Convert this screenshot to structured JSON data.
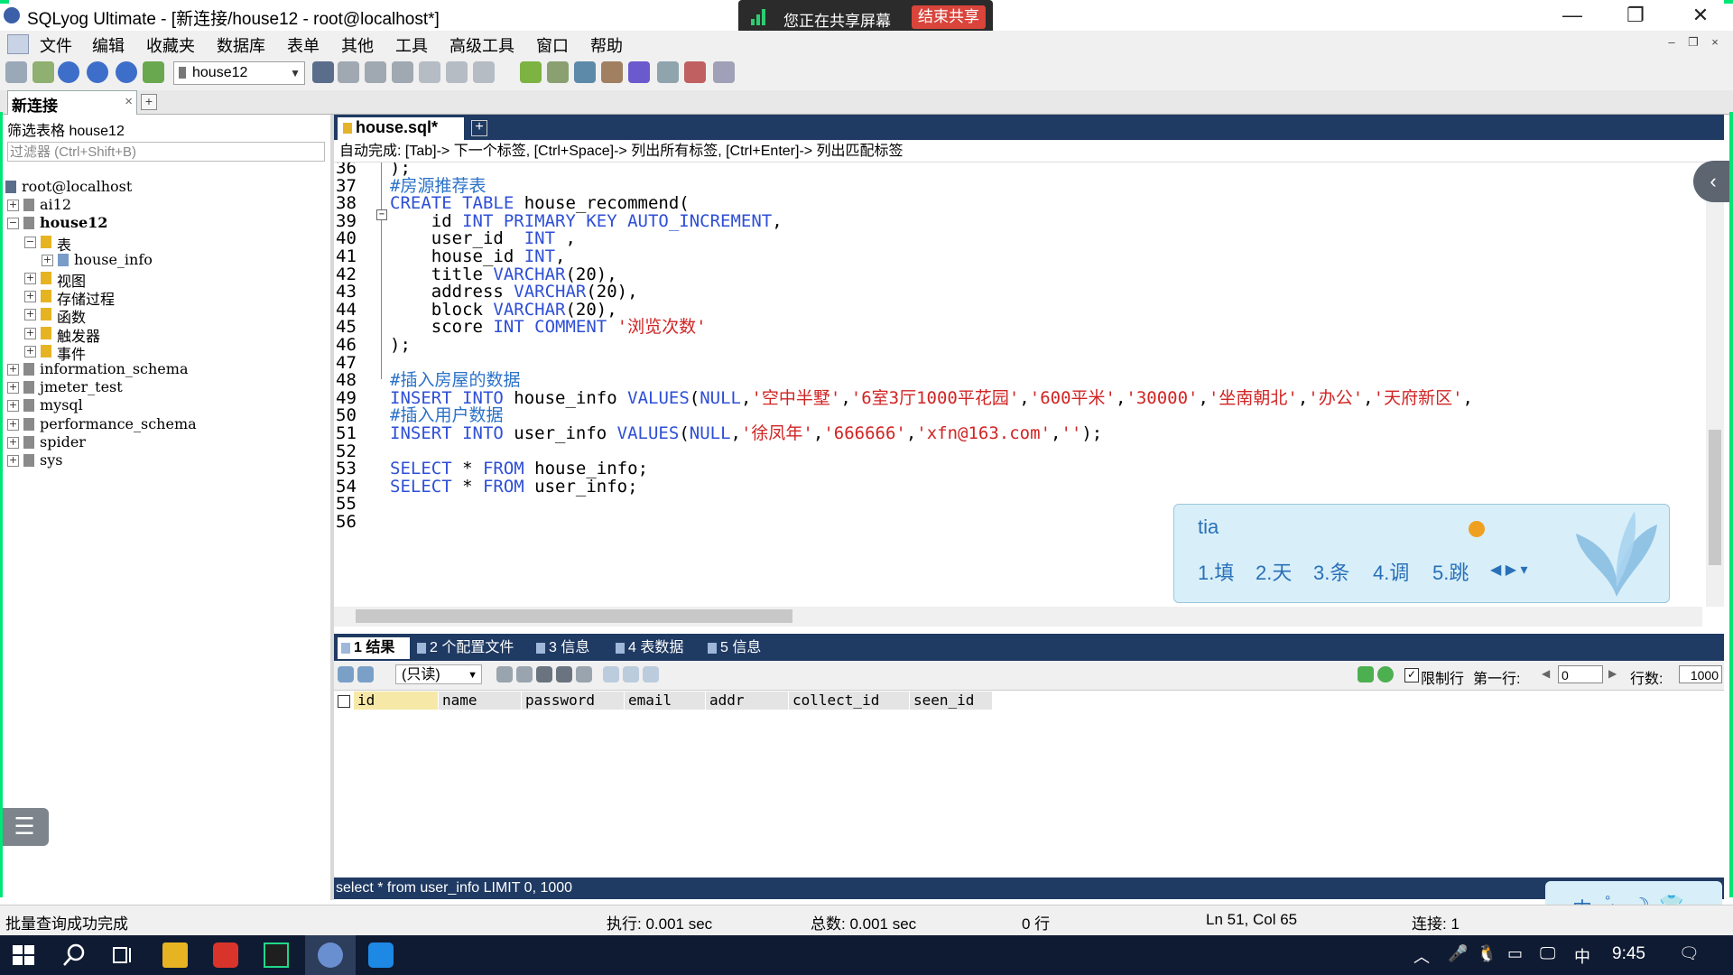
{
  "window": {
    "title": "SQLyog Ultimate - [新连接/house12 - root@localhost*]",
    "controls": [
      "—",
      "❐",
      "✕"
    ]
  },
  "share": {
    "text": "您正在共享屏幕",
    "stop_label": "结束共享"
  },
  "menu": {
    "items": [
      "文件",
      "编辑",
      "收藏夹",
      "数据库",
      "表单",
      "其他",
      "工具",
      "高级工具",
      "窗口",
      "帮助"
    ],
    "mdi_controls": [
      "–",
      "❐",
      "×"
    ]
  },
  "toolbar": {
    "db_select": "house12"
  },
  "connection_tab": {
    "label": "新连接",
    "close": "×",
    "add": "+"
  },
  "left": {
    "filter_label": "筛选表格 house12",
    "filter_placeholder": "过滤器 (Ctrl+Shift+B)",
    "tree": [
      {
        "label": "root@localhost",
        "level": 0,
        "exp": "",
        "icon": "server-icon"
      },
      {
        "label": "ai12",
        "level": 0,
        "exp": "+",
        "icon": "database-icon"
      },
      {
        "label": "house12",
        "level": 0,
        "exp": "−",
        "icon": "database-icon",
        "bold": true
      },
      {
        "label": "表",
        "level": 1,
        "exp": "−",
        "icon": "folder-icon"
      },
      {
        "label": "house_info",
        "level": 2,
        "exp": "+",
        "icon": "table-icon"
      },
      {
        "label": "视图",
        "level": 1,
        "exp": "+",
        "icon": "folder-icon"
      },
      {
        "label": "存储过程",
        "level": 1,
        "exp": "+",
        "icon": "folder-icon"
      },
      {
        "label": "函数",
        "level": 1,
        "exp": "+",
        "icon": "folder-icon"
      },
      {
        "label": "触发器",
        "level": 1,
        "exp": "+",
        "icon": "folder-icon"
      },
      {
        "label": "事件",
        "level": 1,
        "exp": "+",
        "icon": "folder-icon"
      },
      {
        "label": "information_schema",
        "level": 0,
        "exp": "+",
        "icon": "database-icon"
      },
      {
        "label": "jmeter_test",
        "level": 0,
        "exp": "+",
        "icon": "database-icon"
      },
      {
        "label": "mysql",
        "level": 0,
        "exp": "+",
        "icon": "database-icon"
      },
      {
        "label": "performance_schema",
        "level": 0,
        "exp": "+",
        "icon": "database-icon"
      },
      {
        "label": "spider",
        "level": 0,
        "exp": "+",
        "icon": "database-icon"
      },
      {
        "label": "sys",
        "level": 0,
        "exp": "+",
        "icon": "database-icon"
      }
    ]
  },
  "editor": {
    "tab_label": "house.sql*",
    "tab_add": "+",
    "autocomplete_hint": "自动完成: [Tab]-> 下一个标签, [Ctrl+Space]-> 列出所有标签, [Ctrl+Enter]-> 列出匹配标签",
    "lines": [
      {
        "n": "36",
        "parts": [
          [
            "id",
            ");"
          ]
        ]
      },
      {
        "n": "37",
        "parts": [
          [
            "cmt",
            "#房源推荐表"
          ]
        ]
      },
      {
        "n": "38",
        "parts": [
          [
            "kw",
            "CREATE TABLE "
          ],
          [
            "id",
            "house_recommend("
          ]
        ]
      },
      {
        "n": "39",
        "parts": [
          [
            "id",
            "    id "
          ],
          [
            "kw",
            "INT PRIMARY KEY AUTO_INCREMENT"
          ],
          [
            "id",
            ","
          ]
        ]
      },
      {
        "n": "40",
        "parts": [
          [
            "id",
            "    user_id  "
          ],
          [
            "kw",
            "INT"
          ],
          [
            "id",
            " ,"
          ]
        ]
      },
      {
        "n": "41",
        "parts": [
          [
            "id",
            "    house_id "
          ],
          [
            "kw",
            "INT"
          ],
          [
            "id",
            ","
          ]
        ]
      },
      {
        "n": "42",
        "parts": [
          [
            "id",
            "    title "
          ],
          [
            "kw",
            "VARCHAR"
          ],
          [
            "id",
            "(20),"
          ]
        ]
      },
      {
        "n": "43",
        "parts": [
          [
            "id",
            "    address "
          ],
          [
            "kw",
            "VARCHAR"
          ],
          [
            "id",
            "(20),"
          ]
        ]
      },
      {
        "n": "44",
        "parts": [
          [
            "id",
            "    block "
          ],
          [
            "kw",
            "VARCHAR"
          ],
          [
            "id",
            "(20),"
          ]
        ]
      },
      {
        "n": "45",
        "parts": [
          [
            "id",
            "    score "
          ],
          [
            "kw",
            "INT COMMENT "
          ],
          [
            "str",
            "'浏览次数'"
          ]
        ]
      },
      {
        "n": "46",
        "parts": [
          [
            "id",
            ");"
          ]
        ]
      },
      {
        "n": "47",
        "parts": []
      },
      {
        "n": "48",
        "parts": [
          [
            "cmt",
            "#插入房屋的数据"
          ]
        ]
      },
      {
        "n": "49",
        "parts": [
          [
            "kw",
            "INSERT INTO "
          ],
          [
            "id",
            "house_info "
          ],
          [
            "kw",
            "VALUES"
          ],
          [
            "id",
            "("
          ],
          [
            "kw",
            "NULL"
          ],
          [
            "id",
            ","
          ],
          [
            "str",
            "'空中半墅'"
          ],
          [
            "id",
            ","
          ],
          [
            "str",
            "'6室3厅1000平花园'"
          ],
          [
            "id",
            ","
          ],
          [
            "str",
            "'600平米'"
          ],
          [
            "id",
            ","
          ],
          [
            "str",
            "'30000'"
          ],
          [
            "id",
            ","
          ],
          [
            "str",
            "'坐南朝北'"
          ],
          [
            "id",
            ","
          ],
          [
            "str",
            "'办公'"
          ],
          [
            "id",
            ","
          ],
          [
            "str",
            "'天府新区'"
          ],
          [
            "id",
            ","
          ]
        ]
      },
      {
        "n": "50",
        "parts": [
          [
            "cmt",
            "#插入用户数据"
          ]
        ]
      },
      {
        "n": "51",
        "parts": [
          [
            "kw",
            "INSERT INTO "
          ],
          [
            "id",
            "user_info "
          ],
          [
            "kw",
            "VALUES"
          ],
          [
            "id",
            "("
          ],
          [
            "kw",
            "NULL"
          ],
          [
            "id",
            ","
          ],
          [
            "str",
            "'徐凤年'"
          ],
          [
            "id",
            ","
          ],
          [
            "str",
            "'666666'"
          ],
          [
            "id",
            ","
          ],
          [
            "str",
            "'xfn@163.com'"
          ],
          [
            "id",
            ","
          ],
          [
            "str",
            "''"
          ],
          [
            "id",
            ");"
          ]
        ]
      },
      {
        "n": "52",
        "parts": []
      },
      {
        "n": "53",
        "parts": [
          [
            "kw",
            "SELECT"
          ],
          [
            "id",
            " * "
          ],
          [
            "kw",
            "FROM"
          ],
          [
            "id",
            " house_info;"
          ]
        ]
      },
      {
        "n": "54",
        "parts": [
          [
            "kw",
            "SELECT"
          ],
          [
            "id",
            " * "
          ],
          [
            "kw",
            "FROM"
          ],
          [
            "id",
            " user_info;"
          ]
        ]
      },
      {
        "n": "55",
        "parts": []
      },
      {
        "n": "56",
        "parts": []
      }
    ]
  },
  "ime": {
    "input": "tia",
    "candidates": [
      "1.填",
      "2.天",
      "3.条",
      "4.调",
      "5.跳"
    ],
    "mini": [
      "中",
      "°,",
      "☽",
      "👕"
    ]
  },
  "results": {
    "tabs": [
      "1 结果",
      "2 个配置文件",
      "3 信息",
      "4 表数据",
      "5 信息"
    ],
    "readonly": "(只读)",
    "limit_label": "限制行",
    "first_label": "第一行:",
    "first_value": "0",
    "rows_label": "行数:",
    "rows_value": "1000",
    "columns": [
      "id",
      "name",
      "password",
      "email",
      "addr",
      "collect_id",
      "seen_id"
    ],
    "query": "select * from user_info LIMIT 0, 1000"
  },
  "status": {
    "message": "批量查询成功完成",
    "exec": "执行: 0.001 sec",
    "total": "总数: 0.001 sec",
    "rows": "0 行",
    "position": "Ln 51, Col 65",
    "connection": "连接: 1"
  },
  "taskbar": {
    "ime_indicator": "中",
    "clock": "9:45"
  }
}
